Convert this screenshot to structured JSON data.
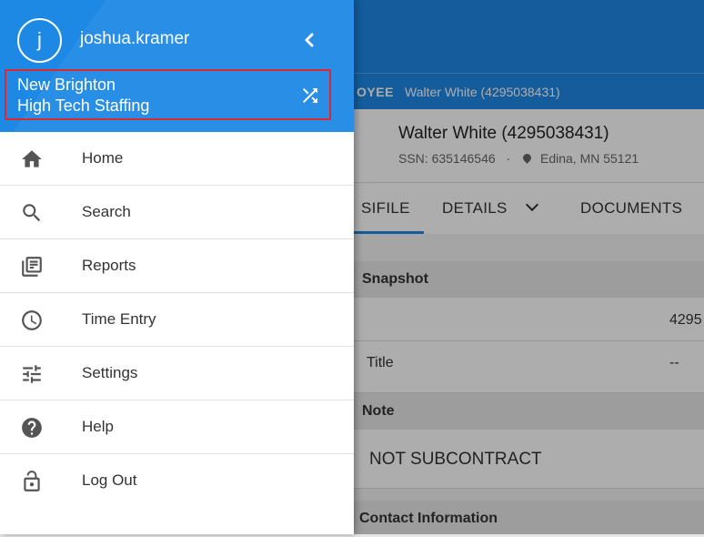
{
  "background": {
    "crumb_label": "OYEE",
    "crumb_value": "Walter White (4295038431)",
    "employee_name": "Walter White (4295038431)",
    "ssn": "SSN: 635146546",
    "separator": "·",
    "location": "Edina, MN 55121",
    "tabs": [
      {
        "label": "SIFILE"
      },
      {
        "label": "DETAILS"
      },
      {
        "label": "DOCUMENTS"
      }
    ],
    "sections": {
      "snapshot": "Snapshot",
      "snapshot_id_value": "4295",
      "title_label": "Title",
      "title_value": "--",
      "note": "Note",
      "note_value": "NOT SUBCONTRACT",
      "contact": "Contact Information"
    }
  },
  "drawer": {
    "avatar_letter": "j",
    "username": "joshua.kramer",
    "branch": {
      "name": "New Brighton",
      "company": "High Tech Staffing"
    },
    "menu": [
      {
        "label": "Home",
        "icon": "home-icon"
      },
      {
        "label": "Search",
        "icon": "search-icon"
      },
      {
        "label": "Reports",
        "icon": "reports-icon"
      },
      {
        "label": "Time Entry",
        "icon": "clock-icon"
      },
      {
        "label": "Settings",
        "icon": "settings-sliders-icon"
      },
      {
        "label": "Help",
        "icon": "help-icon"
      },
      {
        "label": "Log Out",
        "icon": "lock-open-icon"
      }
    ]
  },
  "colors": {
    "primary": "#1e88e5",
    "highlight_border": "#e0282c",
    "icon": "#555555"
  }
}
